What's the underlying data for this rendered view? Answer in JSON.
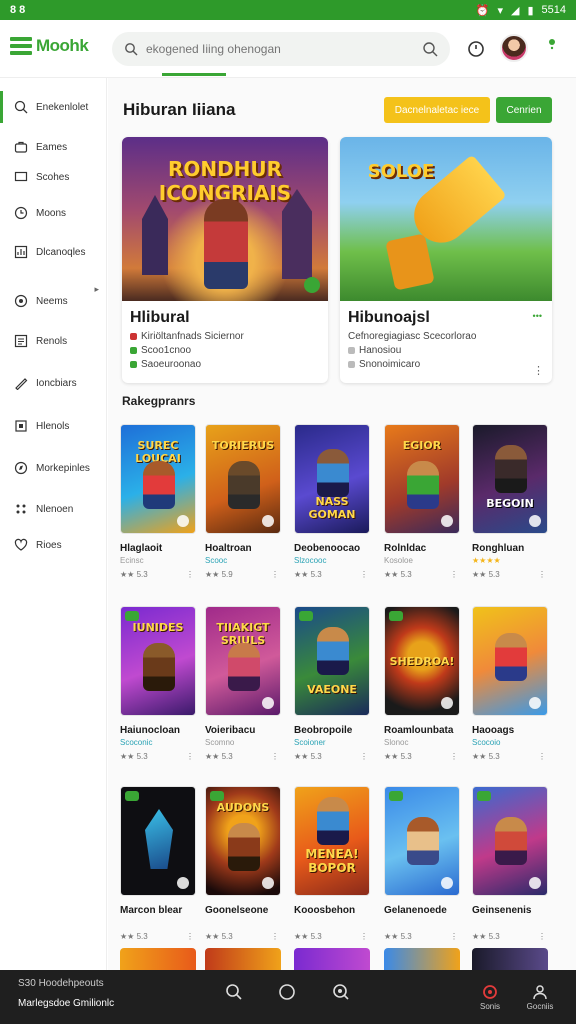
{
  "status": {
    "left": "8 8",
    "time": "5514"
  },
  "header": {
    "logo": "Moohk",
    "search_placeholder": "ekogened Iiing ohenogan"
  },
  "sidebar": {
    "items": [
      {
        "label": "Enekenlolet",
        "icon": "search-icon"
      },
      {
        "label": "Eames",
        "icon": "briefcase-icon"
      },
      {
        "label": "Scohes",
        "icon": "monitor-icon"
      },
      {
        "label": "Moons",
        "icon": "clock-icon"
      },
      {
        "label": "Dlcanoqles",
        "icon": "chart-icon"
      },
      {
        "label": "Neems",
        "icon": "target-icon"
      },
      {
        "label": "Renols",
        "icon": "list-icon"
      },
      {
        "label": "Ioncbiars",
        "icon": "pen-icon"
      },
      {
        "label": "Hlenols",
        "icon": "box-icon"
      },
      {
        "label": "Morkepinles",
        "icon": "compass-icon"
      },
      {
        "label": "Nlenoen",
        "icon": "grid-icon"
      },
      {
        "label": "Rioes",
        "icon": "heart-icon"
      }
    ]
  },
  "main": {
    "title": "Hiburan Iiiana",
    "btn_primary": "Dacnelnaletac iece",
    "btn_secondary": "Cenrien",
    "featured": [
      {
        "art": "RONDHUR ICONGRIAIS",
        "title": "Hlibural",
        "line1": "Kiriöltanfnads Siciernor",
        "line2": "Scoo1cnoo",
        "line3": "Saoeuroonao"
      },
      {
        "art": "SOLOE",
        "title": "Hibunoajsl",
        "line1": "Cefnoregiagiasc Scecorlorao",
        "line2": "Hanosiou",
        "line3": "Snonoimicaro"
      }
    ],
    "section_title": "Rakegpranrs",
    "cards": [
      {
        "art": "SUREC LOUCAI",
        "name": "Hlaglaoit",
        "sub": "Ecinsc",
        "sub_style": "",
        "meta": "★★ 5.3"
      },
      {
        "art": "TORIERUS",
        "name": "Hoaltroan",
        "sub": "Scooc",
        "sub_style": "teal",
        "meta": "★★ 5.9"
      },
      {
        "art": "NASS GOMAN",
        "name": "Deobenoocao",
        "sub": "Slzocooc",
        "sub_style": "teal",
        "meta": "★★ 5.3"
      },
      {
        "art": "EGIOR",
        "name": "Rolnldac",
        "sub": "Kosoloe",
        "sub_style": "",
        "meta": "★★ 5.3"
      },
      {
        "art": "BEGOIN",
        "name": "Ronghluan",
        "sub": "★★★★",
        "sub_style": "gold",
        "meta": "★★ 5.3"
      },
      {
        "art": "IUNIDES",
        "name": "Haiunocloan",
        "sub": "Scoconic",
        "sub_style": "teal",
        "meta": "★★ 5.3"
      },
      {
        "art": "TIIAKIGT SRIULS",
        "name": "Voieribacu",
        "sub": "Scomno",
        "sub_style": "",
        "meta": "★★ 5.3"
      },
      {
        "art": "VAEONE",
        "name": "Beobropoile",
        "sub": "Scoioner",
        "sub_style": "teal",
        "meta": "★★ 5.3"
      },
      {
        "art": "SHEDROA!",
        "name": "Roamlounbata",
        "sub": "Slonoc",
        "sub_style": "",
        "meta": "★★ 5.3"
      },
      {
        "art": "",
        "name": "Haooags",
        "sub": "Scocoio",
        "sub_style": "teal",
        "meta": "★★ 5.3"
      },
      {
        "art": "",
        "name": "Marcon blear",
        "sub": "",
        "sub_style": "",
        "meta": "★★ 5.3"
      },
      {
        "art": "AUDONS",
        "name": "Goonelseone",
        "sub": "",
        "sub_style": "",
        "meta": "★★ 5.3"
      },
      {
        "art": "MENEA! BOPOR",
        "name": "Kooosbehon",
        "sub": "",
        "sub_style": "",
        "meta": "★★ 5.3"
      },
      {
        "art": "",
        "name": "Gelanenoede",
        "sub": "",
        "sub_style": "",
        "meta": "★★ 5.3"
      },
      {
        "art": "",
        "name": "Geinsenenis",
        "sub": "",
        "sub_style": "",
        "meta": "★★ 5.3"
      }
    ]
  },
  "bottom": {
    "line1": "S30 Hoodehpeouts",
    "line2": "Marlegsdoe Gmilionlc",
    "tab1_label": "Sonis",
    "tab2_label": "Gocniis"
  }
}
